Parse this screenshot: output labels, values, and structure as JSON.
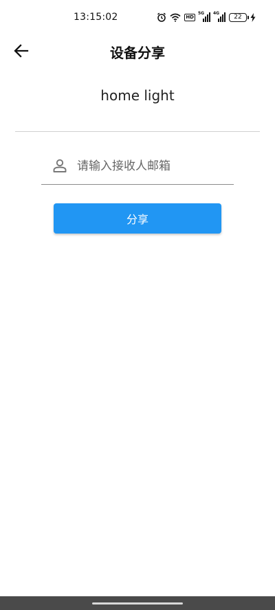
{
  "status_bar": {
    "time": "13:15:02",
    "hd_label": "HD",
    "network_1": "5G",
    "network_2": "4G",
    "battery_level": "22",
    "icons": [
      "alarm-icon",
      "wifi-icon",
      "hd-icon",
      "signal-5g-icon",
      "signal-4g-icon",
      "battery-icon",
      "charging-icon"
    ]
  },
  "app_bar": {
    "title": "设备分享",
    "back_icon": "arrow-left-icon"
  },
  "device": {
    "name": "home light"
  },
  "email_input": {
    "placeholder": "请输入接收人邮箱",
    "value": "",
    "icon": "person-icon"
  },
  "share_button": {
    "label": "分享"
  },
  "colors": {
    "accent": "#2196f3",
    "divider": "#d0d0d0",
    "nav_bar": "#4a4a4a"
  }
}
